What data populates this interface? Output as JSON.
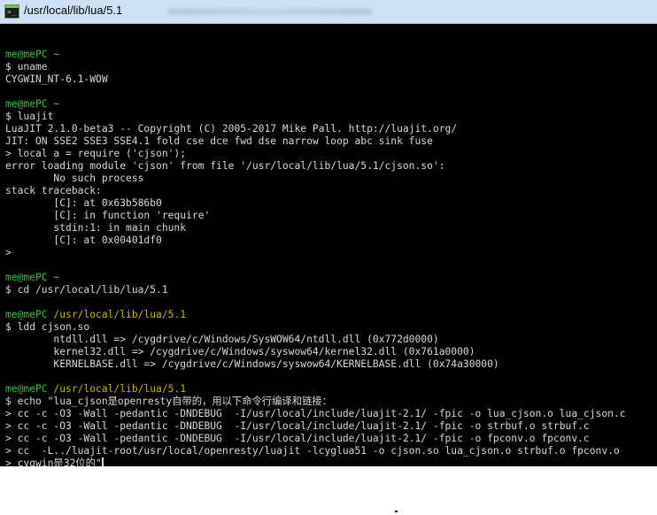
{
  "window": {
    "title": "/usr/local/lib/lua/5.1",
    "icon": "terminal-icon"
  },
  "colors": {
    "background": "#000000",
    "text": "#d8d8d8",
    "prompt_user": "#2ec52e",
    "prompt_path": "#c8b400",
    "titlebar": "#cfe2f5"
  },
  "terminal": {
    "lines": [
      {
        "text": ""
      },
      {
        "user": "me@mePC",
        "path": "~"
      },
      {
        "text": "$ uname"
      },
      {
        "text": "CYGWIN_NT-6.1-WOW"
      },
      {
        "text": ""
      },
      {
        "user": "me@mePC",
        "path": "~"
      },
      {
        "text": "$ luajit"
      },
      {
        "text": "LuaJIT 2.1.0-beta3 -- Copyright (C) 2005-2017 Mike Pall. http://luajit.org/"
      },
      {
        "text": "JIT: ON SSE2 SSE3 SSE4.1 fold cse dce fwd dse narrow loop abc sink fuse"
      },
      {
        "text": "> local a = require ('cjson');"
      },
      {
        "text": "error loading module 'cjson' from file '/usr/local/lib/lua/5.1/cjson.so':"
      },
      {
        "text": "        No such process"
      },
      {
        "text": "stack traceback:"
      },
      {
        "text": "        [C]: at 0x63b586b0"
      },
      {
        "text": "        [C]: in function 'require'"
      },
      {
        "text": "        stdin:1: in main chunk"
      },
      {
        "text": "        [C]: at 0x00401df0"
      },
      {
        "text": ">"
      },
      {
        "text": ""
      },
      {
        "user": "me@mePC",
        "path": "~"
      },
      {
        "text": "$ cd /usr/local/lib/lua/5.1"
      },
      {
        "text": ""
      },
      {
        "user": "me@mePC",
        "path": "/usr/local/lib/lua/5.1"
      },
      {
        "text": "$ ldd cjson.so"
      },
      {
        "text": "        ntdll.dll => /cygdrive/c/Windows/SysWOW64/ntdll.dll (0x772d0000)"
      },
      {
        "text": "        kernel32.dll => /cygdrive/c/Windows/syswow64/kernel32.dll (0x761a0000)"
      },
      {
        "text": "        KERNELBASE.dll => /cygdrive/c/Windows/syswow64/KERNELBASE.dll (0x74a30000)"
      },
      {
        "text": ""
      },
      {
        "user": "me@mePC",
        "path": "/usr/local/lib/lua/5.1"
      },
      {
        "text": "$ echo \"lua_cjson是openresty自带的，用以下命令行编译和链接："
      },
      {
        "text": "> cc -c -O3 -Wall -pedantic -DNDEBUG  -I/usr/local/include/luajit-2.1/ -fpic -o lua_cjson.o lua_cjson.c"
      },
      {
        "text": "> cc -c -O3 -Wall -pedantic -DNDEBUG  -I/usr/local/include/luajit-2.1/ -fpic -o strbuf.o strbuf.c"
      },
      {
        "text": "> cc -c -O3 -Wall -pedantic -DNDEBUG  -I/usr/local/include/luajit-2.1/ -fpic -o fpconv.o fpconv.c"
      },
      {
        "text": "> cc  -L../luajit-root/usr/local/openresty/luajit -lcyglua51 -o cjson.so lua_cjson.o strbuf.o fpconv.o"
      },
      {
        "text": "> cygwin是32位的\"",
        "cursor": true
      }
    ]
  }
}
